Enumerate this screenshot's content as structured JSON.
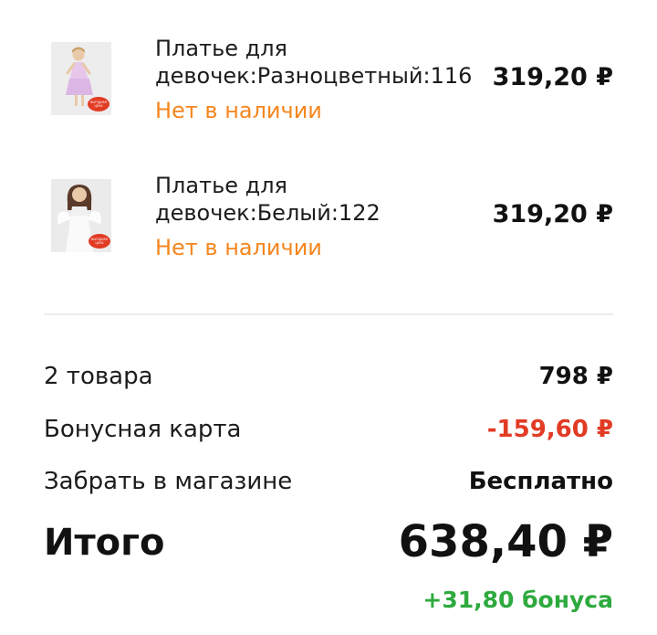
{
  "cart": {
    "items": [
      {
        "name": "Платье для девочек:Разноцветный:116",
        "availability": "Нет в наличии",
        "price": "319,20 ₽",
        "image": "girl-dress-pink-photo",
        "sticker": "ВЫГОДНАЯ ЦЕНА"
      },
      {
        "name": "Платье для девочек:Белый:122",
        "availability": "Нет в наличии",
        "price": "319,20 ₽",
        "image": "girl-dress-white-photo",
        "sticker": "ВЫГОДНАЯ ЦЕНА"
      }
    ]
  },
  "summary": {
    "goods_label": "2 товара",
    "goods_value": "798 ₽",
    "bonus_card_label": "Бонусная карта",
    "bonus_card_value": "-159,60 ₽",
    "pickup_label": "Забрать в магазине",
    "pickup_value": "Бесплатно",
    "total_label": "Итого",
    "total_value": "638,40 ₽",
    "bonus_earned": "+31,80 бонуса"
  },
  "colors": {
    "availability": "#f5861f",
    "discount": "#e23b24",
    "bonus": "#2eaa3e",
    "divider": "#ececec"
  }
}
